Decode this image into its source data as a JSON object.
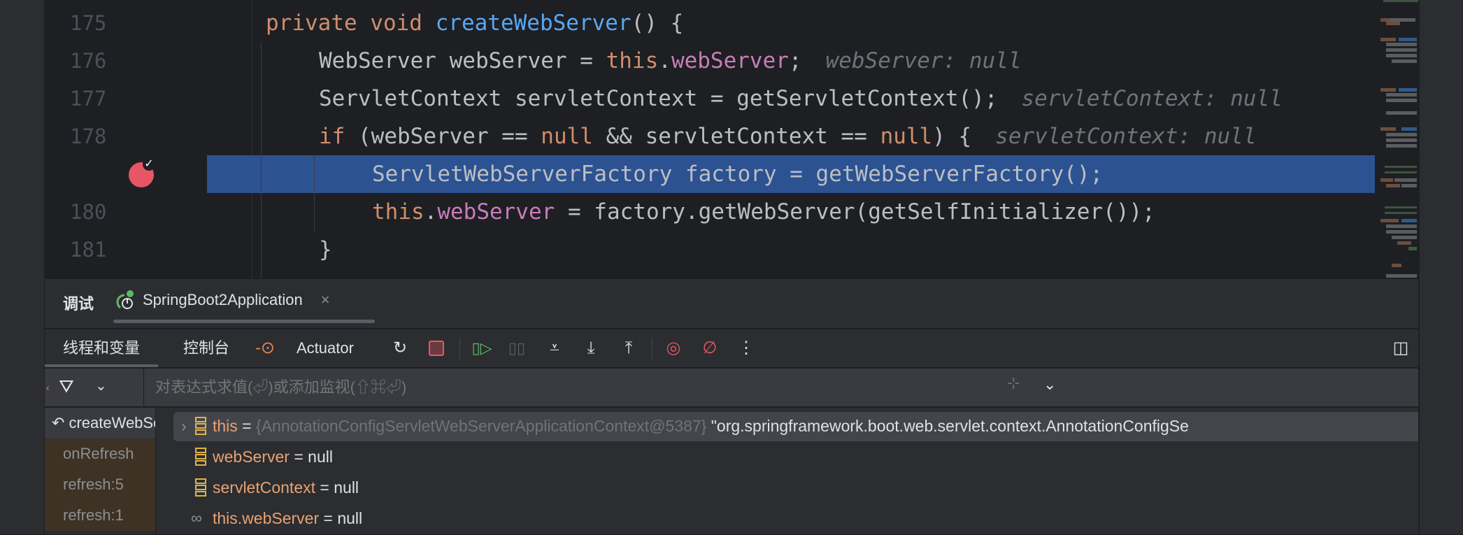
{
  "editor": {
    "lines": [
      {
        "number": "175",
        "tokens": [
          [
            "private void ",
            "keyword"
          ],
          [
            "createWebServer",
            "method"
          ],
          [
            "() {",
            "plain"
          ]
        ],
        "indent": 1
      },
      {
        "number": "176",
        "tokens": [
          [
            "WebServer webServer = ",
            "plain"
          ],
          [
            "this",
            "keyword"
          ],
          [
            ".",
            "plain"
          ],
          [
            "webServer",
            "field"
          ],
          [
            ";",
            "plain"
          ]
        ],
        "hint": "webServer: null",
        "indent": 2
      },
      {
        "number": "177",
        "tokens": [
          [
            "ServletContext servletContext = getServletContext();",
            "plain"
          ]
        ],
        "hint": "servletContext: null",
        "indent": 2
      },
      {
        "number": "178",
        "tokens": [
          [
            "if ",
            "keyword"
          ],
          [
            "(webServer == ",
            "plain"
          ],
          [
            "null",
            "keyword"
          ],
          [
            " && servletContext == ",
            "plain"
          ],
          [
            "null",
            "keyword"
          ],
          [
            ") {",
            "plain"
          ]
        ],
        "hint": "servletContext: null",
        "indent": 2
      },
      {
        "number": "",
        "tokens": [
          [
            "ServletWebServerFactory factory = getWebServerFactory();",
            "plain"
          ]
        ],
        "indent": 3,
        "highlighted": true,
        "breakpoint": "breakpoint-verified-icon"
      },
      {
        "number": "180",
        "tokens": [
          [
            "this",
            "keyword"
          ],
          [
            ".",
            "plain"
          ],
          [
            "webServer",
            "field"
          ],
          [
            " = factory.getWebServer(getSelfInitializer());",
            "plain"
          ]
        ],
        "indent": 3
      },
      {
        "number": "181",
        "tokens": [
          [
            "}",
            "plain"
          ]
        ],
        "indent": 2
      }
    ],
    "colors": {
      "keyword": "#cf8e6d",
      "method": "#56a8f5",
      "field": "#c77dbb",
      "execution_line": "#2c5291",
      "breakpoint": "#e55765"
    }
  },
  "debug": {
    "title": "调试",
    "session_tab": {
      "label": "SpringBoot2Application",
      "icon": "spring-debug-icon",
      "close": "×"
    },
    "tabs": [
      {
        "label": "线程和变量",
        "active": true
      },
      {
        "label": "控制台"
      },
      {
        "label": "Actuator",
        "icon": "actuator-icon"
      }
    ],
    "actions": [
      "rerun-icon",
      "stop-icon",
      "resume-icon",
      "pause-icon",
      "step-over-icon",
      "step-into-icon",
      "step-out-icon",
      "view-breakpoints-icon",
      "mute-breakpoints-icon",
      "more-icon"
    ],
    "eval_placeholder": "对表达式求值(⏎)或添加监视(⇧⌘⏎)",
    "frames": [
      {
        "label": "createWebServer",
        "selected": true
      },
      {
        "label": "onRefresh"
      },
      {
        "label": "refresh:5"
      },
      {
        "label": "refresh:1"
      }
    ],
    "variables": [
      {
        "name": "this",
        "eq": " = ",
        "type": "{AnnotationConfigServletWebServerApplicationContext@5387}",
        "value": " \"org.springframework.boot.web.servlet.context.AnnotationConfigSe",
        "expandable": true,
        "icon": "field-icon"
      },
      {
        "name": "webServer",
        "eq": " = ",
        "value": "null",
        "icon": "field-icon"
      },
      {
        "name": "servletContext",
        "eq": " = ",
        "value": "null",
        "icon": "field-icon"
      },
      {
        "name": "this.webServer",
        "eq": " = ",
        "value": "null",
        "icon": "watch-icon"
      }
    ]
  }
}
